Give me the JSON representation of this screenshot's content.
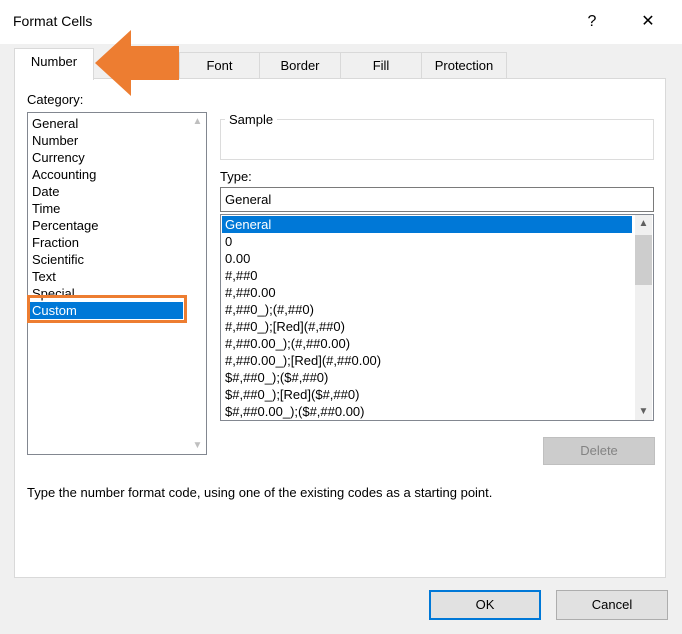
{
  "window": {
    "title": "Format Cells",
    "help_glyph": "?",
    "close_glyph": "✕"
  },
  "tabs": [
    {
      "label": "Number",
      "active": true
    },
    {
      "label": "Font"
    },
    {
      "label": "Border"
    },
    {
      "label": "Fill"
    },
    {
      "label": "Protection"
    }
  ],
  "category": {
    "label": "Category:",
    "items": [
      "General",
      "Number",
      "Currency",
      "Accounting",
      "Date",
      "Time",
      "Percentage",
      "Fraction",
      "Scientific",
      "Text",
      "Special",
      "Custom"
    ],
    "selected": "Custom"
  },
  "sample": {
    "label": "Sample",
    "value": ""
  },
  "type": {
    "label": "Type:",
    "value": "General",
    "options": [
      "General",
      "0",
      "0.00",
      "#,##0",
      "#,##0.00",
      "#,##0_);(#,##0)",
      "#,##0_);[Red](#,##0)",
      "#,##0.00_);(#,##0.00)",
      "#,##0.00_);[Red](#,##0.00)",
      "$#,##0_);($#,##0)",
      "$#,##0_);[Red]($#,##0)",
      "$#,##0.00_);($#,##0.00)"
    ],
    "selected": "General"
  },
  "buttons": {
    "delete": "Delete",
    "ok": "OK",
    "cancel": "Cancel"
  },
  "description": "Type the number format code, using one of the existing codes as a starting point.",
  "colors": {
    "accent": "#0078d7",
    "annotation": "#ed7d31"
  }
}
